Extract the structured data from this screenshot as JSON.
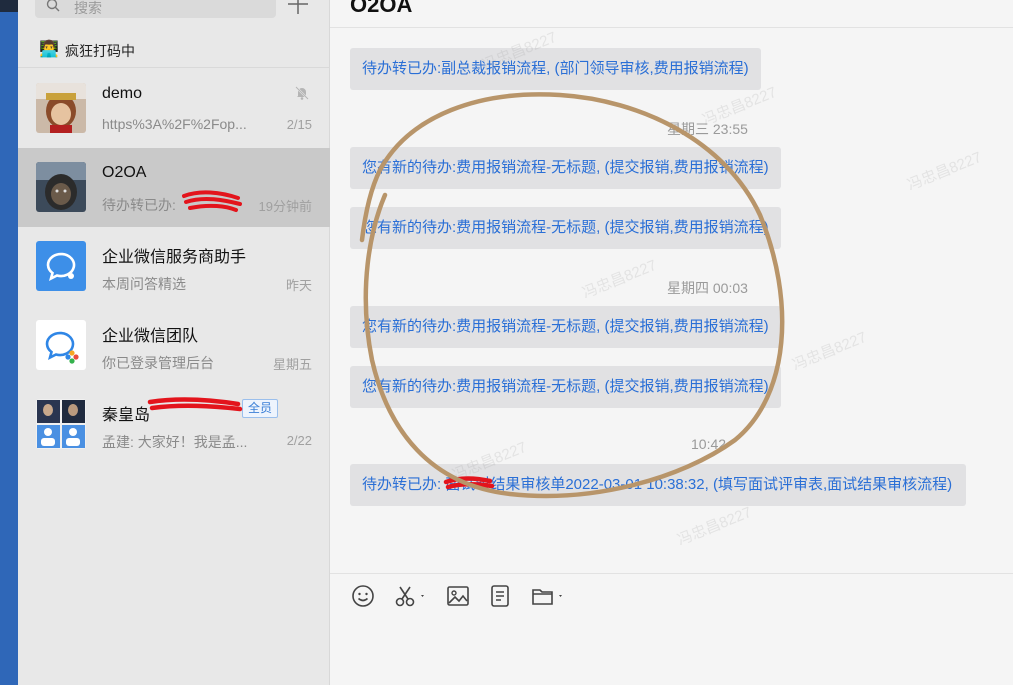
{
  "sidebar": {
    "search_placeholder": "搜索",
    "status_emoji": "👨‍💻",
    "status_text": "疯狂打码中",
    "chats": [
      {
        "name": "demo",
        "preview": "https%3A%2F%2Fop...",
        "time": "2/15",
        "muted": true
      },
      {
        "name": "O2OA",
        "preview": "待办转已办:",
        "time": "19分钟前",
        "selected": true
      },
      {
        "name": "企业微信服务商助手",
        "preview": "本周问答精选",
        "time": "昨天"
      },
      {
        "name": "企业微信团队",
        "preview": "你已登录管理后台",
        "time": "星期五"
      },
      {
        "name": "秦皇岛",
        "preview": "孟建: 大家好！我是孟...",
        "time": "2/22",
        "badge": "全员"
      }
    ]
  },
  "main": {
    "title": "O2OA",
    "messages": [
      "待办转已办:副总裁报销流程, (部门领导审核,费用报销流程)",
      "您有新的待办:费用报销流程-无标题, (提交报销,费用报销流程)",
      "您有新的待办:费用报销流程-无标题, (提交报销,费用报销流程)",
      "您有新的待办:费用报销流程-无标题, (提交报销,费用报销流程)",
      "您有新的待办:费用报销流程-无标题, (提交报销,费用报销流程)",
      "待办转已办:        面试时结果审核单2022-03-01 10:38:32, (填写面试评审表,面试结果审核流程)"
    ],
    "timestamps": [
      "星期三 23:55",
      "星期四 00:03",
      "10:42"
    ],
    "watermark": "冯忠昌8227"
  },
  "toolbar": {
    "icons": [
      "emoji-icon",
      "scissors-icon",
      "image-icon",
      "document-icon",
      "folder-icon"
    ]
  },
  "colors": {
    "accent_blue": "#2a6fd6",
    "sidebar_bg": "#e8e8e8",
    "selected_bg": "#c9c9c9",
    "circle_annotation": "#b8956a",
    "redaction": "#e3141c"
  }
}
